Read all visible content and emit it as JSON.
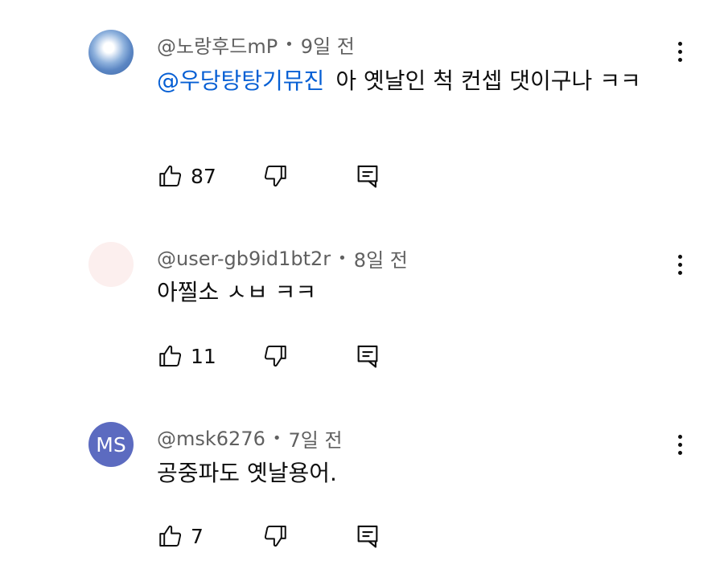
{
  "comments": [
    {
      "author": "@노랑후드mP",
      "separator": "•",
      "time": "9일 전",
      "mention": "@우당탕탕기뮤진",
      "text": "아 옛날인 척 컨셉 댓이구나 ㅋㅋ",
      "likes": "87",
      "avatar": {
        "style": "sky-cloud-photo"
      }
    },
    {
      "author": "@user-gb9id1bt2r",
      "separator": "•",
      "time": "8일 전",
      "mention": "",
      "text": "아찔소 ㅅㅂ ㅋㅋ",
      "likes": "11",
      "avatar": {
        "style": "pink-circle"
      }
    },
    {
      "author": "@msk6276",
      "separator": "•",
      "time": "7일 전",
      "mention": "",
      "text": "공중파도 옛날용어.",
      "likes": "7",
      "avatar": {
        "style": "initials",
        "initials": "MS",
        "color": "#5c6bc0"
      }
    }
  ],
  "icons": {
    "like": "thumb-up-icon",
    "dislike": "thumb-down-icon",
    "reply": "reply-icon",
    "more": "more-vert-icon"
  },
  "colors": {
    "mention": "#065fd4",
    "meta": "#606060",
    "text": "#0f0f0f"
  }
}
